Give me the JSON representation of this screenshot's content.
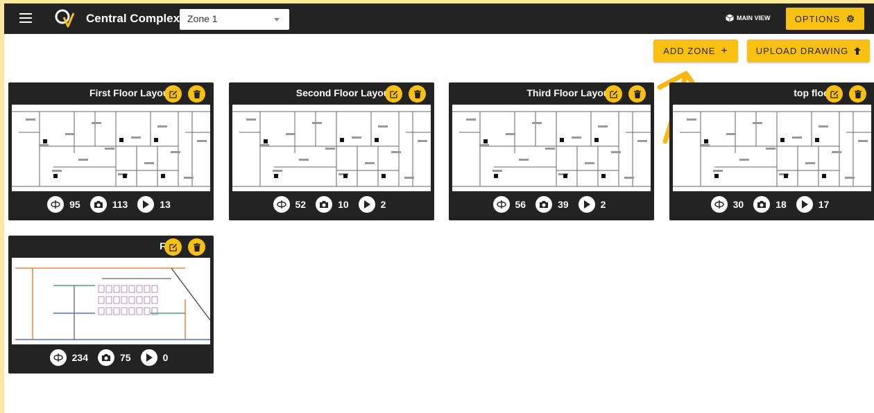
{
  "header": {
    "app_title": "Central Complex",
    "zone_select_value": "Zone 1",
    "main_view_label": "MAIN VIEW",
    "options_label": "OPTIONS"
  },
  "actions": {
    "add_zone_label": "ADD ZONE",
    "add_zone_icon": "+",
    "upload_drawing_label": "UPLOAD DRAWING"
  },
  "colors": {
    "accent": "#f9c014",
    "dark": "#232323"
  },
  "cards": [
    {
      "title": "First Floor Layout",
      "panoramas": "95",
      "photos": "113",
      "videos": "13"
    },
    {
      "title": "Second Floor Layout",
      "panoramas": "52",
      "photos": "10",
      "videos": "2"
    },
    {
      "title": "Third Floor Layout",
      "panoramas": "56",
      "photos": "39",
      "videos": "2"
    },
    {
      "title": "top floor",
      "panoramas": "30",
      "photos": "18",
      "videos": "17"
    },
    {
      "title": "Flr",
      "panoramas": "234",
      "photos": "75",
      "videos": "0"
    }
  ]
}
